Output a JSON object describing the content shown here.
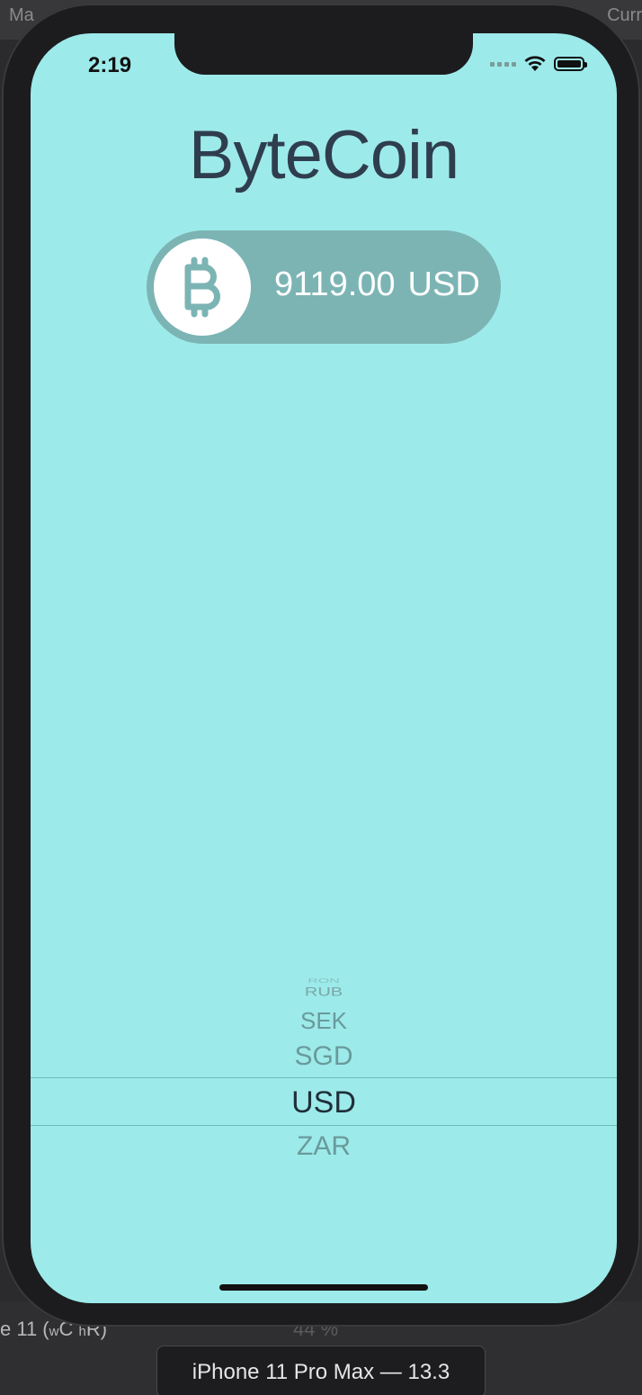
{
  "xcode": {
    "top_left_fragment": "Ma",
    "top_right_fragment": "Curr",
    "bottom_size_prefix": "e 11 (",
    "bottom_size_w": "w",
    "bottom_size_c": "C ",
    "bottom_size_h": "h",
    "bottom_size_suffix": "R)",
    "zoom": "44 %",
    "device": "iPhone 11 Pro Max — 13.3"
  },
  "status_bar": {
    "time": "2:19",
    "icons": [
      "signal-icon",
      "wifi-icon",
      "battery-icon"
    ]
  },
  "app": {
    "title": "ByteCoin",
    "coin_icon": "bitcoin-icon",
    "rate_value": "9119.00",
    "rate_currency": "USD"
  },
  "picker": {
    "items_above": [
      "RON",
      "RUB",
      "SEK",
      "SGD"
    ],
    "selected": "USD",
    "items_below": [
      "ZAR"
    ]
  },
  "colors": {
    "background": "#9deaea",
    "pill": "#7cb4b4",
    "title_text": "#2f3e4e"
  }
}
